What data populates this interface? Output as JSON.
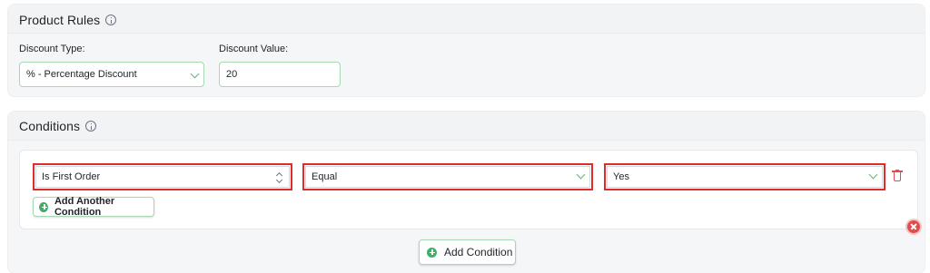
{
  "product_rules": {
    "title": "Product Rules",
    "info_icon": "info-icon",
    "discount_type": {
      "label": "Discount Type:",
      "selected": "% - Percentage Discount"
    },
    "discount_value": {
      "label": "Discount Value:",
      "value": "20"
    }
  },
  "conditions": {
    "title": "Conditions",
    "info_icon": "info-icon",
    "rows": [
      {
        "field": "Is First Order",
        "operator": "Equal",
        "value": "Yes"
      }
    ],
    "add_another_label": "Add Another Condition",
    "add_condition_label": "Add Condition"
  },
  "colors": {
    "accent_green": "#3fae66",
    "highlight_red": "#e02b2b",
    "danger_red": "#e24c4c"
  }
}
